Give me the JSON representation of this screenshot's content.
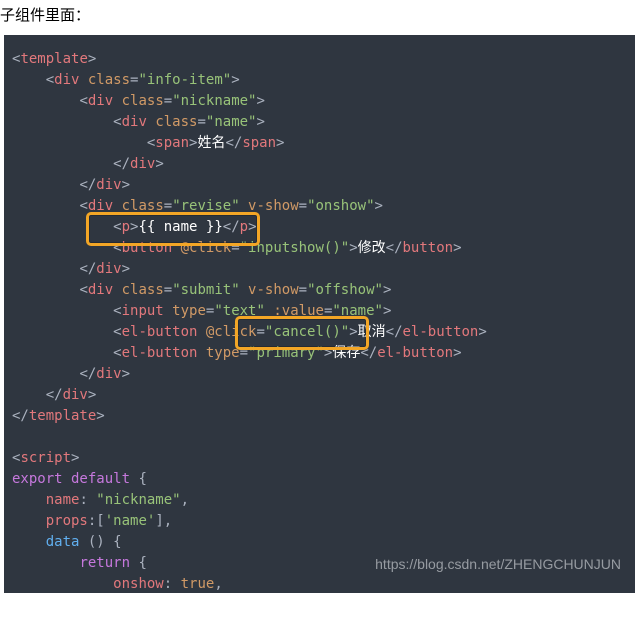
{
  "heading": "子组件里面：",
  "watermark": "https://blog.csdn.net/ZHENGCHUNJUN",
  "code": {
    "l01_a": "<",
    "l01_b": "template",
    "l01_c": ">",
    "l02_a": "<",
    "l02_b": "div",
    "l02_c": " class",
    "l02_d": "=",
    "l02_e": "\"info-item\"",
    "l02_f": ">",
    "l03_a": "<",
    "l03_b": "div",
    "l03_c": " class",
    "l03_d": "=",
    "l03_e": "\"nickname\"",
    "l03_f": ">",
    "l04_a": "<",
    "l04_b": "div",
    "l04_c": " class",
    "l04_d": "=",
    "l04_e": "\"name\"",
    "l04_f": ">",
    "l05_a": "<",
    "l05_b": "span",
    "l05_c": ">",
    "l05_d": "姓名",
    "l05_e": "</",
    "l05_f": "span",
    "l05_g": ">",
    "l06_a": "</",
    "l06_b": "div",
    "l06_c": ">",
    "l07_a": "</",
    "l07_b": "div",
    "l07_c": ">",
    "l08_a": "<",
    "l08_b": "div",
    "l08_c": " class",
    "l08_d": "=",
    "l08_e": "\"revise\"",
    "l08_f": " v-show",
    "l08_g": "=",
    "l08_h": "\"onshow\"",
    "l08_i": ">",
    "l09_a": "<",
    "l09_b": "p",
    "l09_c": ">",
    "l09_d": "{{ name }}",
    "l09_e": "</",
    "l09_f": "p",
    "l09_g": ">",
    "l10_a": "<",
    "l10_b": "button",
    "l10_c": " @click",
    "l10_d": "=",
    "l10_e": "\"inputshow()\"",
    "l10_f": ">",
    "l10_g": "修改",
    "l10_h": "</",
    "l10_i": "button",
    "l10_j": ">",
    "l11_a": "</",
    "l11_b": "div",
    "l11_c": ">",
    "l12_a": "<",
    "l12_b": "div",
    "l12_c": " class",
    "l12_d": "=",
    "l12_e": "\"submit\"",
    "l12_f": " v-show",
    "l12_g": "=",
    "l12_h": "\"offshow\"",
    "l12_i": ">",
    "l13_a": "<",
    "l13_b": "input",
    "l13_c": " type",
    "l13_d": "=",
    "l13_e": "\"text\"",
    "l13_f": " :value",
    "l13_g": "=",
    "l13_h": "\"name\"",
    "l13_i": ">",
    "l14_a": "<",
    "l14_b": "el-button",
    "l14_c": " @click",
    "l14_d": "=",
    "l14_e": "\"cancel()\"",
    "l14_f": ">",
    "l14_g": "取消",
    "l14_h": "</",
    "l14_i": "el-button",
    "l14_j": ">",
    "l15_a": "<",
    "l15_b": "el-button",
    "l15_c": " type",
    "l15_d": "=",
    "l15_e": "\"primary\"",
    "l15_f": ">",
    "l15_g": "保存",
    "l15_h": "</",
    "l15_i": "el-button",
    "l15_j": ">",
    "l16_a": "</",
    "l16_b": "div",
    "l16_c": ">",
    "l17_a": "</",
    "l17_b": "div",
    "l17_c": ">",
    "l18_a": "</",
    "l18_b": "template",
    "l18_c": ">",
    "l19": "",
    "l20_a": "<",
    "l20_b": "script",
    "l20_c": ">",
    "l21_a": "export",
    "l21_b": " default",
    "l21_c": " {",
    "l22_a": "name",
    "l22_b": ": ",
    "l22_c": "\"nickname\"",
    "l22_d": ",",
    "l23_a": "props",
    "l23_b": ":[",
    "l23_c": "'name'",
    "l23_d": "],",
    "l24_a": "data ",
    "l24_b": "()",
    "l24_c": " {",
    "l25_a": "return",
    "l25_b": " {",
    "l26_a": "onshow",
    "l26_b": ": ",
    "l26_c": "true",
    "l26_d": ","
  }
}
